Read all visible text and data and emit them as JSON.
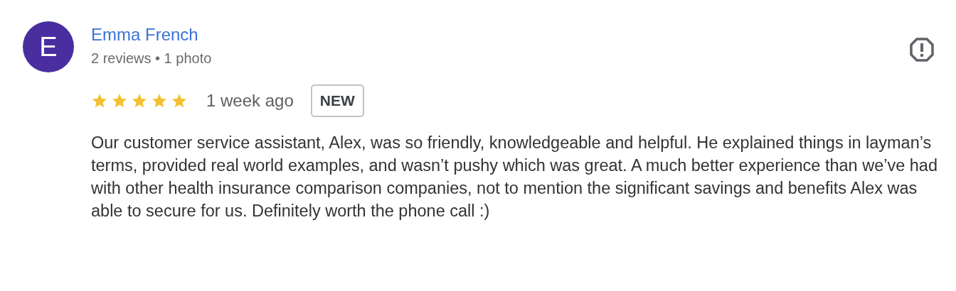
{
  "review": {
    "avatar_letter": "E",
    "author": "Emma French",
    "meta": "2 reviews • 1 photo",
    "stars": 5,
    "time": "1 week ago",
    "badge": "NEW",
    "text": "Our customer service assistant, Alex, was so friendly, knowledgeable and helpful. He explained things in layman’s terms, provided real world examples, and wasn’t pushy which was great. A much better experience than we’ve had with other health insurance comparison companies, not to mention the significant savings and benefits Alex was able to secure for us. Definitely worth the phone call :)"
  }
}
